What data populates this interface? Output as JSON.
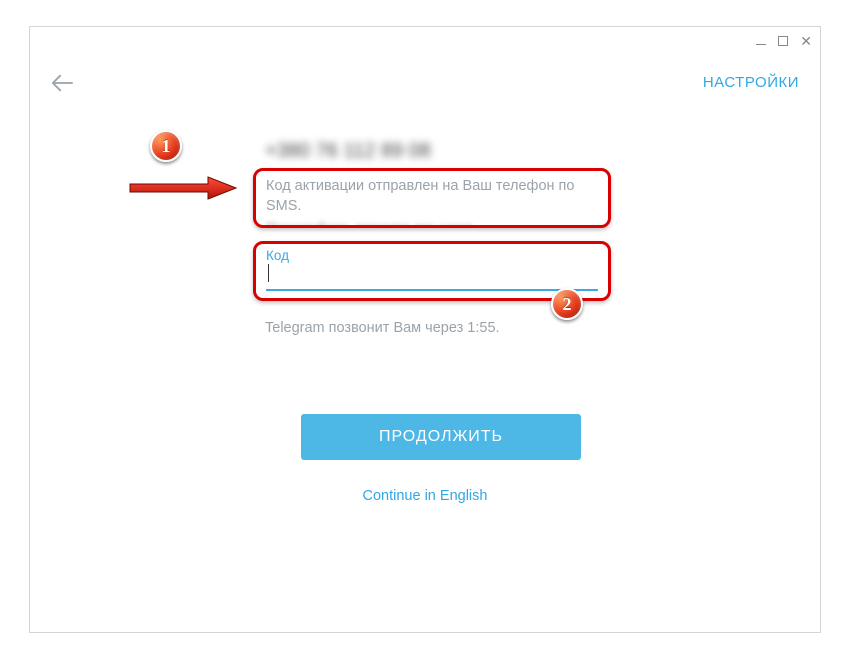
{
  "header": {
    "settings_label": "НАСТРОЙКИ"
  },
  "verify": {
    "phone_display": "+380 76 112 89 08",
    "sms_message": "Код активации отправлен на Ваш телефон по SMS.",
    "sms_message_clipped": "Пожалуйста, введите его ниже.",
    "input_label": "Код",
    "call_hint": "Telegram позвонит Вам через 1:55."
  },
  "actions": {
    "continue_label": "ПРОДОЛЖИТЬ",
    "english_link": "Continue in English"
  },
  "annotations": {
    "badge1": "1",
    "badge2": "2"
  }
}
